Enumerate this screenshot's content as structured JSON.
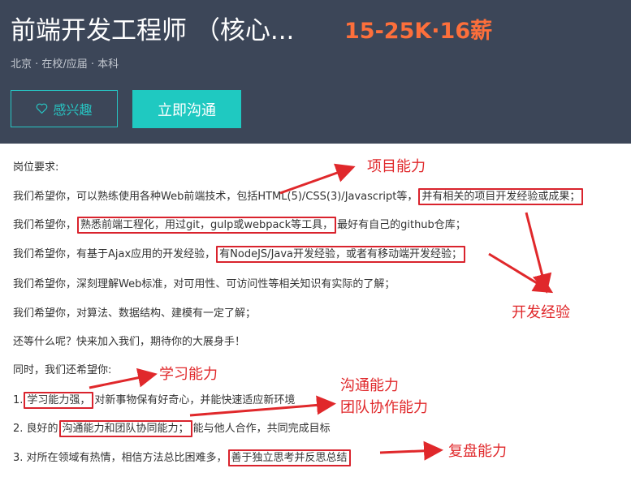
{
  "header": {
    "title": "前端开发工程师 （核心...",
    "salary": "15-25K·16薪",
    "meta": "北京 · 在校/应届 · 本科",
    "interest_button": "感兴趣",
    "chat_button": "立即沟通"
  },
  "requirements": {
    "heading": "岗位要求:",
    "line1_a": "我们希望你，可以熟练使用各种Web前端技术，包括HTML(5)/CSS(3)/Javascript等，",
    "line1_hl": "并有相关的项目开发经验或成果；",
    "line2_a": "我们希望你，",
    "line2_hl": "熟悉前端工程化，用过git，gulp或webpack等工具，",
    "line2_b": "最好有自己的github仓库；",
    "line3_a": "我们希望你，有基于Ajax应用的开发经验，",
    "line3_hl": "有NodeJS/Java开发经验，或者有移动端开发经验；",
    "line4": "我们希望你，深刻理解Web标准，对可用性、可访问性等相关知识有实际的了解；",
    "line5": "我们希望你，对算法、数据结构、建模有一定了解；",
    "line6": "还等什么呢？快来加入我们，期待你的大展身手！",
    "line7": "同时，我们还希望你:",
    "item1_num": "1.",
    "item1_hl": "学习能力强，",
    "item1_b": "对新事物保有好奇心，并能快速适应新环境",
    "item2_num": "2. 良好的",
    "item2_hl": "沟通能力和团队协同能力；",
    "item2_b": "能与他人合作，共同完成目标",
    "item3_num": "3. 对所在领域有热情，相信方法总比困难多，",
    "item3_hl": "善于独立思考并反思总结"
  },
  "annotations": {
    "project": "项目能力",
    "dev_exp": "开发经验",
    "learning": "学习能力",
    "communication": "沟通能力",
    "teamwork": "团队协作能力",
    "review": "复盘能力"
  },
  "colors": {
    "header_bg": "#3c4658",
    "accent_teal": "#1fc9c1",
    "salary_orange": "#fd6f3b",
    "highlight_red": "#d9232d"
  }
}
